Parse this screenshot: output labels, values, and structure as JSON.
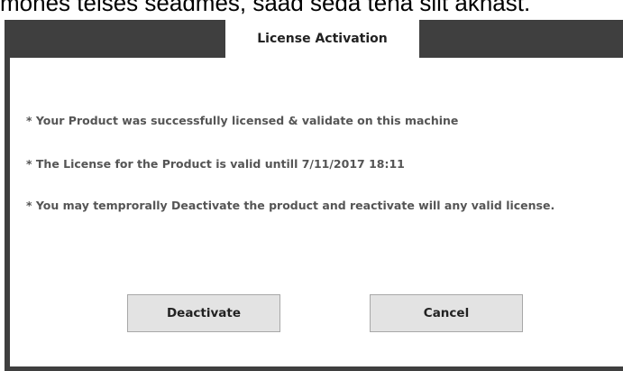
{
  "background_caption": "mones teises seadmes, saad seda teha siit aknast.",
  "dialog": {
    "title": "License Activation",
    "messages": [
      "* Your Product was successfully licensed & validate on this machine",
      "* The License for the Product is valid untill 7/11/2017 18:11",
      "* You may temprorally Deactivate the product and reactivate will any valid license."
    ],
    "buttons": {
      "deactivate_label": "Deactivate",
      "cancel_label": "Cancel"
    }
  },
  "colors": {
    "title_bar": "#3f3f3f",
    "content_bg": "#ffffff",
    "message_text": "#555555",
    "button_bg": "#e3e3e3"
  }
}
